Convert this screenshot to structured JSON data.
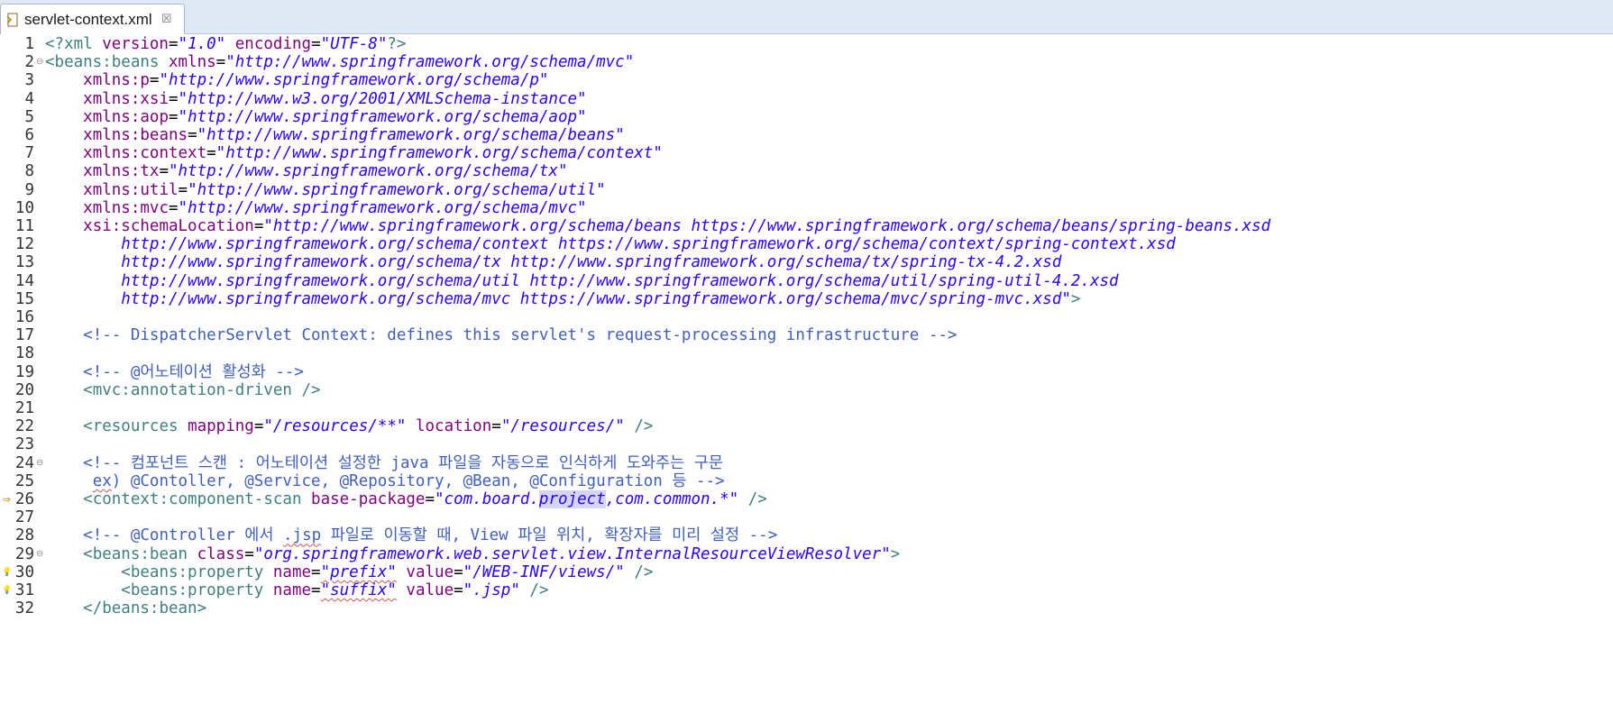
{
  "tab": {
    "label": "servlet-context.xml",
    "close": "☒"
  },
  "lines": [
    {
      "n": "1",
      "parts": [
        [
          "tag",
          "<?xml "
        ],
        [
          "attr",
          "version"
        ],
        [
          "txt",
          "="
        ],
        [
          "val",
          "\"1.0\""
        ],
        [
          "txt",
          " "
        ],
        [
          "attr",
          "encoding"
        ],
        [
          "txt",
          "="
        ],
        [
          "val",
          "\"UTF-8\""
        ],
        [
          "tag",
          "?>"
        ]
      ]
    },
    {
      "n": "2",
      "fold": "⊖",
      "parts": [
        [
          "tag",
          "<beans:beans "
        ],
        [
          "attr",
          "xmlns"
        ],
        [
          "txt",
          "="
        ],
        [
          "val",
          "\"http://www.springframework.org/schema/mvc\""
        ]
      ]
    },
    {
      "n": "3",
      "parts": [
        [
          "txt",
          "    "
        ],
        [
          "attr",
          "xmlns:p"
        ],
        [
          "txt",
          "="
        ],
        [
          "val",
          "\"http://www.springframework.org/schema/p\""
        ]
      ]
    },
    {
      "n": "4",
      "parts": [
        [
          "txt",
          "    "
        ],
        [
          "attr",
          "xmlns:xsi"
        ],
        [
          "txt",
          "="
        ],
        [
          "val",
          "\"http://www.w3.org/2001/XMLSchema-instance\""
        ]
      ]
    },
    {
      "n": "5",
      "parts": [
        [
          "txt",
          "    "
        ],
        [
          "attr",
          "xmlns:aop"
        ],
        [
          "txt",
          "="
        ],
        [
          "val",
          "\"http://www.springframework.org/schema/aop\""
        ]
      ]
    },
    {
      "n": "6",
      "parts": [
        [
          "txt",
          "    "
        ],
        [
          "attr",
          "xmlns:beans"
        ],
        [
          "txt",
          "="
        ],
        [
          "val",
          "\"http://www.springframework.org/schema/beans\""
        ]
      ]
    },
    {
      "n": "7",
      "parts": [
        [
          "txt",
          "    "
        ],
        [
          "attr",
          "xmlns:context"
        ],
        [
          "txt",
          "="
        ],
        [
          "val",
          "\"http://www.springframework.org/schema/context\""
        ]
      ]
    },
    {
      "n": "8",
      "parts": [
        [
          "txt",
          "    "
        ],
        [
          "attr",
          "xmlns:tx"
        ],
        [
          "txt",
          "="
        ],
        [
          "val",
          "\"http://www.springframework.org/schema/tx\""
        ]
      ]
    },
    {
      "n": "9",
      "parts": [
        [
          "txt",
          "    "
        ],
        [
          "attr",
          "xmlns:util"
        ],
        [
          "txt",
          "="
        ],
        [
          "val",
          "\"http://www.springframework.org/schema/util\""
        ]
      ]
    },
    {
      "n": "10",
      "parts": [
        [
          "txt",
          "    "
        ],
        [
          "attr",
          "xmlns:mvc"
        ],
        [
          "txt",
          "="
        ],
        [
          "val",
          "\"http://www.springframework.org/schema/mvc\""
        ]
      ]
    },
    {
      "n": "11",
      "parts": [
        [
          "txt",
          "    "
        ],
        [
          "attr",
          "xsi:schemaLocation"
        ],
        [
          "txt",
          "="
        ],
        [
          "val",
          "\"http://www.springframework.org/schema/beans https://www.springframework.org/schema/beans/spring-beans.xsd"
        ]
      ]
    },
    {
      "n": "12",
      "parts": [
        [
          "txt",
          "        "
        ],
        [
          "val",
          "http://www.springframework.org/schema/context https://www.springframework.org/schema/context/spring-context.xsd"
        ]
      ]
    },
    {
      "n": "13",
      "parts": [
        [
          "txt",
          "        "
        ],
        [
          "val",
          "http://www.springframework.org/schema/tx http://www.springframework.org/schema/tx/spring-tx-4.2.xsd"
        ]
      ]
    },
    {
      "n": "14",
      "parts": [
        [
          "txt",
          "        "
        ],
        [
          "val",
          "http://www.springframework.org/schema/util http://www.springframework.org/schema/util/spring-util-4.2.xsd"
        ]
      ]
    },
    {
      "n": "15",
      "parts": [
        [
          "txt",
          "        "
        ],
        [
          "val",
          "http://www.springframework.org/schema/mvc https://www.springframework.org/schema/mvc/spring-mvc.xsd\""
        ],
        [
          "tag",
          ">"
        ]
      ]
    },
    {
      "n": "16",
      "parts": []
    },
    {
      "n": "17",
      "parts": [
        [
          "txt",
          "    "
        ],
        [
          "cmt",
          "<!-- DispatcherServlet Context: defines this servlet's request-processing infrastructure -->"
        ]
      ]
    },
    {
      "n": "18",
      "parts": []
    },
    {
      "n": "19",
      "parts": [
        [
          "txt",
          "    "
        ],
        [
          "cmt",
          "<!-- @어노테이션 활성화 -->"
        ]
      ]
    },
    {
      "n": "20",
      "parts": [
        [
          "txt",
          "    "
        ],
        [
          "tag",
          "<mvc:annotation-driven />"
        ]
      ]
    },
    {
      "n": "21",
      "parts": []
    },
    {
      "n": "22",
      "parts": [
        [
          "txt",
          "    "
        ],
        [
          "tag",
          "<resources "
        ],
        [
          "attr",
          "mapping"
        ],
        [
          "txt",
          "="
        ],
        [
          "val",
          "\"/resources/**\""
        ],
        [
          "txt",
          " "
        ],
        [
          "attr",
          "location"
        ],
        [
          "txt",
          "="
        ],
        [
          "val",
          "\"/resources/\""
        ],
        [
          "tag",
          " />"
        ]
      ]
    },
    {
      "n": "23",
      "parts": []
    },
    {
      "n": "24",
      "fold": "⊖",
      "parts": [
        [
          "txt",
          "    "
        ],
        [
          "cmt",
          "<!-- 컴포넌트 스캔 : 어노테이션 설정한 java 파일을 자동으로 인식하게 도와주는 구문"
        ]
      ]
    },
    {
      "n": "25",
      "parts": [
        [
          "txt",
          "     "
        ],
        [
          "cmt-sq",
          "ex"
        ],
        [
          "cmt",
          ") @Contoller, @Service, @Repository, @Bean, @Configuration 등 -->"
        ]
      ]
    },
    {
      "n": "26",
      "mark": "⇒",
      "parts": [
        [
          "txt",
          "    "
        ],
        [
          "tag",
          "<context:component-scan "
        ],
        [
          "attr",
          "base-package"
        ],
        [
          "txt",
          "="
        ],
        [
          "val",
          "\"com.board."
        ],
        [
          "val-hl",
          "project"
        ],
        [
          "val",
          ",com.common.*\""
        ],
        [
          "tag",
          " />"
        ]
      ]
    },
    {
      "n": "27",
      "parts": []
    },
    {
      "n": "28",
      "parts": [
        [
          "txt",
          "    "
        ],
        [
          "cmt",
          "<!-- @Controller 에서 "
        ],
        [
          "cmt-sq",
          ".jsp"
        ],
        [
          "cmt",
          " 파일로 이동할 때, View 파일 위치, 확장자를 미리 설정 -->"
        ]
      ]
    },
    {
      "n": "29",
      "fold": "⊖",
      "parts": [
        [
          "txt",
          "    "
        ],
        [
          "tag",
          "<beans:bean "
        ],
        [
          "attr",
          "class"
        ],
        [
          "txt",
          "="
        ],
        [
          "val",
          "\"org.springframework.web.servlet.view.InternalResourceViewResolver\""
        ],
        [
          "tag",
          ">"
        ]
      ]
    },
    {
      "n": "30",
      "mark": "💡",
      "parts": [
        [
          "txt",
          "        "
        ],
        [
          "tag",
          "<beans:property "
        ],
        [
          "attr",
          "name"
        ],
        [
          "txt",
          "="
        ],
        [
          "val-sq",
          "\"prefix\""
        ],
        [
          "txt",
          " "
        ],
        [
          "attr",
          "value"
        ],
        [
          "txt",
          "="
        ],
        [
          "val",
          "\"/WEB-INF/views/\""
        ],
        [
          "tag",
          " />"
        ]
      ]
    },
    {
      "n": "31",
      "mark": "💡",
      "parts": [
        [
          "txt",
          "        "
        ],
        [
          "tag",
          "<beans:property "
        ],
        [
          "attr",
          "name"
        ],
        [
          "txt",
          "="
        ],
        [
          "val-sq",
          "\"suffix\""
        ],
        [
          "txt",
          " "
        ],
        [
          "attr",
          "value"
        ],
        [
          "txt",
          "="
        ],
        [
          "val",
          "\".jsp\""
        ],
        [
          "tag",
          " />"
        ]
      ]
    },
    {
      "n": "32",
      "parts": [
        [
          "txt",
          "    "
        ],
        [
          "tag",
          "</beans:bean>"
        ]
      ]
    }
  ]
}
